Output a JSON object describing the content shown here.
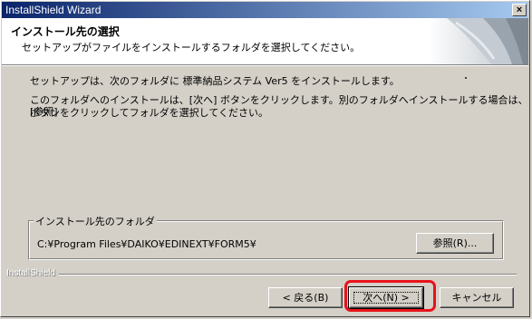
{
  "window": {
    "title": "InstallShield Wizard",
    "close_label": "×"
  },
  "header": {
    "title": "インストール先の選択",
    "subtitle": "セットアップがファイルをインストールするフォルダを選択してください。"
  },
  "body": {
    "line1": "セットアップは、次のフォルダに 標準納品システム Ver5 をインストールします。",
    "line2": "このフォルダへのインストールは、[次へ] ボタンをクリックします。別のフォルダへインストールする場合は、[参照]",
    "line3": "ボタンをクリックしてフォルダを選択してください。"
  },
  "destination": {
    "group_label": "インストール先のフォルダ",
    "path": "C:¥Program Files¥DAIKO¥EDINEXT¥FORM5¥",
    "browse_label": "参照(R)..."
  },
  "footer": {
    "brand": "InstallShield",
    "back_label": "< 戻る(B)",
    "next_label": "次へ(N) >",
    "cancel_label": "キャンセル"
  },
  "colors": {
    "titlebar_start": "#0a246a",
    "titlebar_end": "#a6caf0",
    "dialog_bg": "#d4d0c8",
    "highlight": "#e8121b"
  }
}
